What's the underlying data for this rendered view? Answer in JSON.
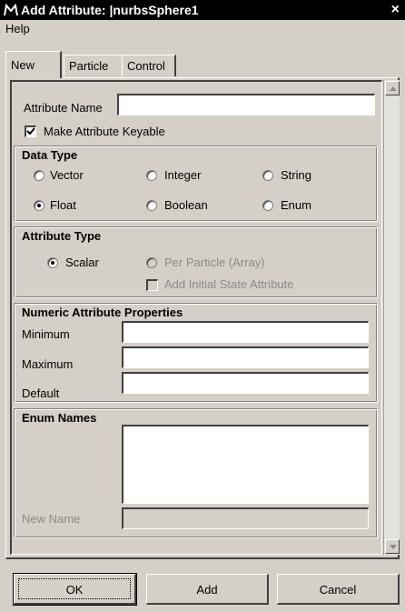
{
  "window": {
    "title": "Add Attribute: |nurbsSphere1",
    "close": "×"
  },
  "menu": {
    "help": "Help"
  },
  "tabs": [
    {
      "label": "New"
    },
    {
      "label": "Particle"
    },
    {
      "label": "Control"
    }
  ],
  "attribute": {
    "name_label": "Attribute Name",
    "name_value": "",
    "keyable_label": "Make Attribute Keyable",
    "keyable_checked": true
  },
  "data_type": {
    "title": "Data Type",
    "options": [
      {
        "label": "Vector",
        "selected": false
      },
      {
        "label": "Integer",
        "selected": false
      },
      {
        "label": "String",
        "selected": false
      },
      {
        "label": "Float",
        "selected": true
      },
      {
        "label": "Boolean",
        "selected": false
      },
      {
        "label": "Enum",
        "selected": false
      }
    ]
  },
  "attribute_type": {
    "title": "Attribute Type",
    "scalar": "Scalar",
    "per_particle": "Per Particle (Array)",
    "initial_state": "Add Initial State Attribute"
  },
  "numeric": {
    "title": "Numeric Attribute Properties",
    "minimum": "Minimum",
    "maximum": "Maximum",
    "default": "Default"
  },
  "enum": {
    "title": "Enum Names",
    "new_name": "New Name"
  },
  "buttons": {
    "ok": "OK",
    "add": "Add",
    "cancel": "Cancel"
  },
  "colors": {
    "title_bar": "#000000",
    "face": "#d4d0c8",
    "disabled_text": "#8a8a8a"
  }
}
